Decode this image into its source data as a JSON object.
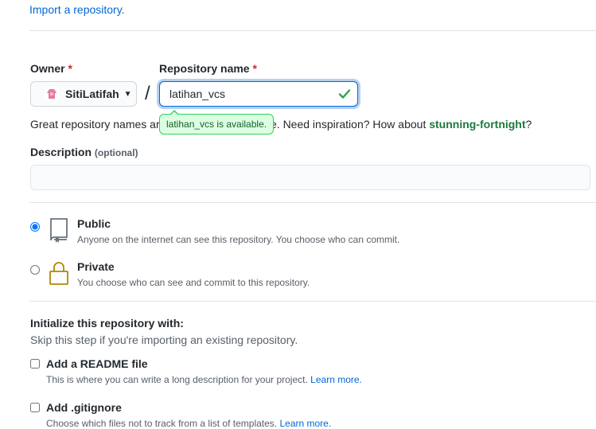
{
  "import_link": "Import a repository.",
  "owner": {
    "label": "Owner",
    "required_mark": "*",
    "selected": "SitiLatifah",
    "avatar_icon": "octocat-avatar-icon"
  },
  "separator": "/",
  "repo_name": {
    "label": "Repository name",
    "required_mark": "*",
    "value": "latihan_vcs",
    "valid_icon": "check-icon",
    "availability_tooltip": "latihan_vcs is available.",
    "valid_color": "#28a745"
  },
  "hint": {
    "prefix": "Great repository names are",
    "suffix": "e. Need inspiration? How about",
    "suggestion": "stunning-fortnight",
    "end": "?"
  },
  "description": {
    "label": "Description",
    "optional": "(optional)",
    "value": ""
  },
  "visibility": {
    "public": {
      "title": "Public",
      "note": "Anyone on the internet can see this repository. You choose who can commit.",
      "checked": true,
      "icon": "repo-icon"
    },
    "private": {
      "title": "Private",
      "note": "You choose who can see and commit to this repository.",
      "checked": false,
      "icon": "lock-icon"
    }
  },
  "init": {
    "heading": "Initialize this repository with:",
    "skip_note": "Skip this step if you're importing an existing repository.",
    "readme": {
      "title": "Add a README file",
      "note": "This is where you can write a long description for your project.",
      "link": "Learn more.",
      "checked": false
    },
    "gitignore": {
      "title": "Add .gitignore",
      "note": "Choose which files not to track from a list of templates.",
      "link": "Learn more.",
      "checked": false
    }
  },
  "colors": {
    "link": "#0366d6",
    "private_icon": "#b08800"
  }
}
